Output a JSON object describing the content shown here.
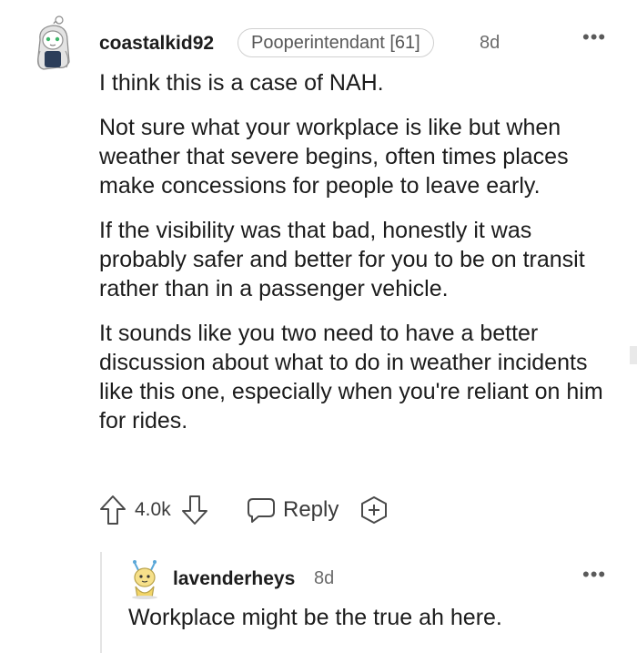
{
  "comment": {
    "username": "coastalkid92",
    "flair": "Pooperintendant [61]",
    "age": "8d",
    "more_glyph": "•••",
    "paragraphs": [
      "I think this is a case of NAH.",
      "Not sure what your workplace is like but when weather that severe begins, often times places make concessions for people to leave early.",
      "If the visibility was that bad, honestly it was probably safer and better for you to be on transit rather than in a passenger vehicle.",
      "It sounds like you two need to have a better discussion about what to do in weather incidents like this one, especially when you're reliant on him for rides."
    ],
    "actions": {
      "upvote_icon": "arrow-up-icon",
      "score": "4.0k",
      "downvote_icon": "arrow-down-icon",
      "reply_icon": "speech-bubble-icon",
      "reply_label": "Reply",
      "award_icon": "plus-circle-icon"
    }
  },
  "reply": {
    "username": "lavenderheys",
    "age": "8d",
    "more_glyph": "•••",
    "body": "Workplace might be the true ah here."
  },
  "colors": {
    "text": "#1c1c1c",
    "meta": "#6a6a6a",
    "icon": "#4a4a4a",
    "thread_line": "#e4e4e4"
  }
}
